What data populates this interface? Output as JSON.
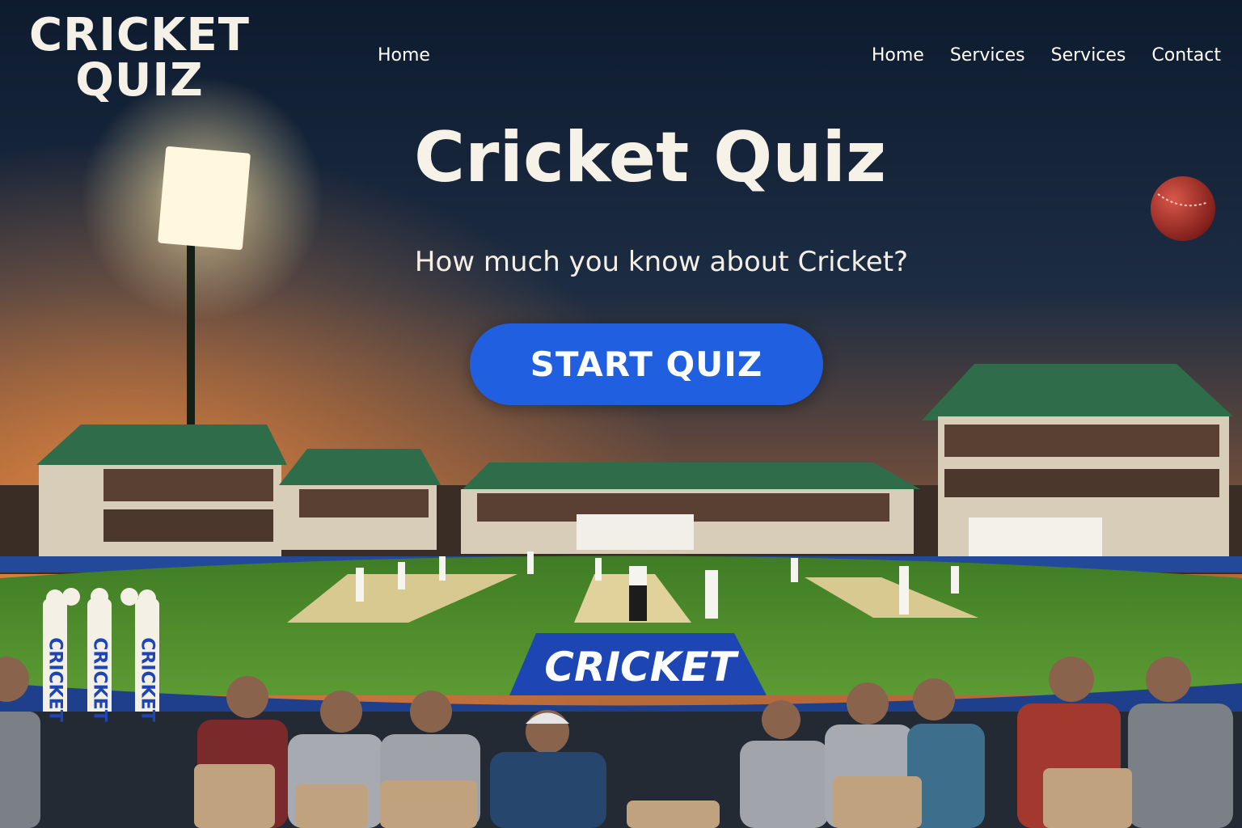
{
  "logo": {
    "line1": "CRICKET",
    "line2": "QUIZ"
  },
  "nav_left": {
    "home": "Home"
  },
  "nav_right": [
    {
      "label": "Home"
    },
    {
      "label": "Services"
    },
    {
      "label": "Services"
    },
    {
      "label": "Contact"
    }
  ],
  "hero": {
    "title": "Cricket Quiz",
    "subtitle": "How much you know about Cricket?",
    "button": "START QUIZ"
  },
  "field": {
    "sign_text": "CRICKET",
    "stump_text": "CRICKET"
  },
  "colors": {
    "accent": "#1f5fe0",
    "pitch": "#4f8f2e",
    "sky_top": "#0f1e33",
    "sky_glow": "#c9733a"
  }
}
